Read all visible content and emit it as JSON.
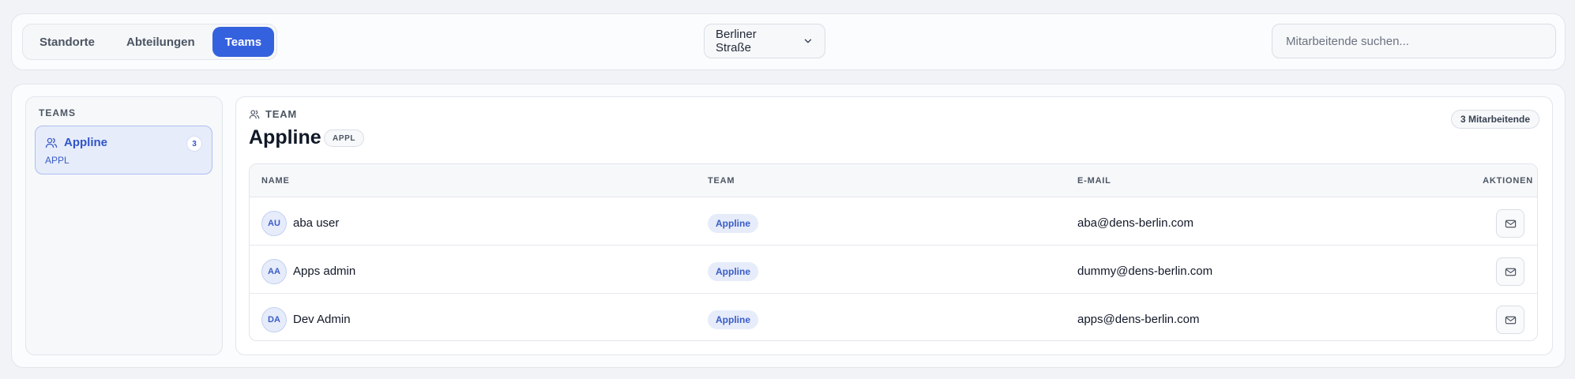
{
  "tabs": [
    {
      "label": "Standorte",
      "active": false
    },
    {
      "label": "Abteilungen",
      "active": false
    },
    {
      "label": "Teams",
      "active": true
    }
  ],
  "location_select": {
    "value": "Berliner Straße",
    "icon": "chevron-down-icon"
  },
  "search": {
    "placeholder": "Mitarbeitende suchen...",
    "value": ""
  },
  "sidebar": {
    "title": "TEAMS",
    "items": [
      {
        "name": "Appline",
        "code": "APPL",
        "count": "3",
        "icon": "users-icon",
        "selected": true
      }
    ]
  },
  "content": {
    "context_label": "TEAM",
    "title": "Appline",
    "title_badge": "APPL",
    "count_badge": "3 Mitarbeitende",
    "columns": [
      "NAME",
      "TEAM",
      "E-MAIL",
      "AKTIONEN"
    ],
    "rows": [
      {
        "initials": "AU",
        "name": "aba user",
        "team": "Appline",
        "email": "aba@dens-berlin.com"
      },
      {
        "initials": "AA",
        "name": "Apps admin",
        "team": "Appline",
        "email": "dummy@dens-berlin.com"
      },
      {
        "initials": "DA",
        "name": "Dev Admin",
        "team": "Appline",
        "email": "apps@dens-berlin.com"
      }
    ],
    "row_action_icon": "mail-icon"
  },
  "colors": {
    "accent": "#3461de",
    "accent_soft": "#e6ecfa",
    "background": "#f1f3f7",
    "text": "#111827"
  }
}
